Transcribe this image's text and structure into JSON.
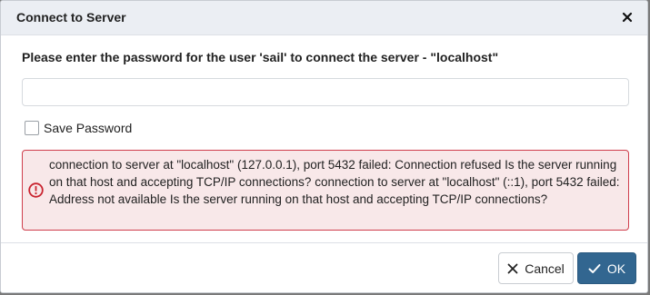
{
  "dialog": {
    "title": "Connect to Server",
    "prompt": "Please enter the password for the user 'sail' to connect the server - \"localhost\"",
    "password_value": "",
    "save_password_label": "Save Password",
    "save_password_checked": false,
    "error_message": "connection to server at \"localhost\" (127.0.0.1), port 5432 failed: Connection refused Is the server running on that host and accepting TCP/IP connections? connection to server at \"localhost\" (::1), port 5432 failed: Address not available Is the server running on that host and accepting TCP/IP connections?",
    "error_icon": "exclamation-circle-icon",
    "close_icon": "close-icon"
  },
  "footer": {
    "cancel_label": "Cancel",
    "cancel_icon": "x-icon",
    "ok_label": "OK",
    "ok_icon": "checkmark-icon"
  },
  "colors": {
    "primary": "#326690",
    "error_border": "#cf3e4c",
    "error_bg": "#f8e8e9",
    "titlebar_bg": "#ebeef3"
  }
}
